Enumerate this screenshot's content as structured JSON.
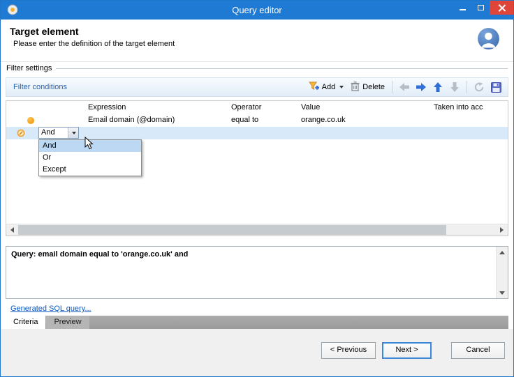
{
  "window": {
    "title": "Query editor"
  },
  "header": {
    "title": "Target element",
    "subtitle": "Please enter the definition of the target element"
  },
  "filter_settings": {
    "label": "Filter settings"
  },
  "toolbar": {
    "filter_conditions": "Filter conditions",
    "add": "Add",
    "delete": "Delete"
  },
  "table": {
    "columns": [
      "Expression",
      "Operator",
      "Value",
      "Taken into acc"
    ],
    "row1": {
      "expression": "Email domain (@domain)",
      "operator": "equal to",
      "value": "orange.co.uk"
    },
    "combo_value": "And",
    "dropdown": {
      "options": [
        "And",
        "Or",
        "Except"
      ],
      "highlighted": "And"
    }
  },
  "query": {
    "text": "Query: email domain equal to 'orange.co.uk' and"
  },
  "links": {
    "sql": "Generated SQL query..."
  },
  "tabs": {
    "criteria": "Criteria",
    "preview": "Preview"
  },
  "buttons": {
    "previous": "< Previous",
    "next": "Next >",
    "cancel": "Cancel"
  },
  "colors": {
    "titlebar": "#1e7ad2",
    "close_button": "#e0453a",
    "selection_row": "#d8e9fa",
    "dropdown_highlight": "#bcd8f2",
    "toolbar_accent": "#2a63b0",
    "link": "#0a58c0"
  }
}
